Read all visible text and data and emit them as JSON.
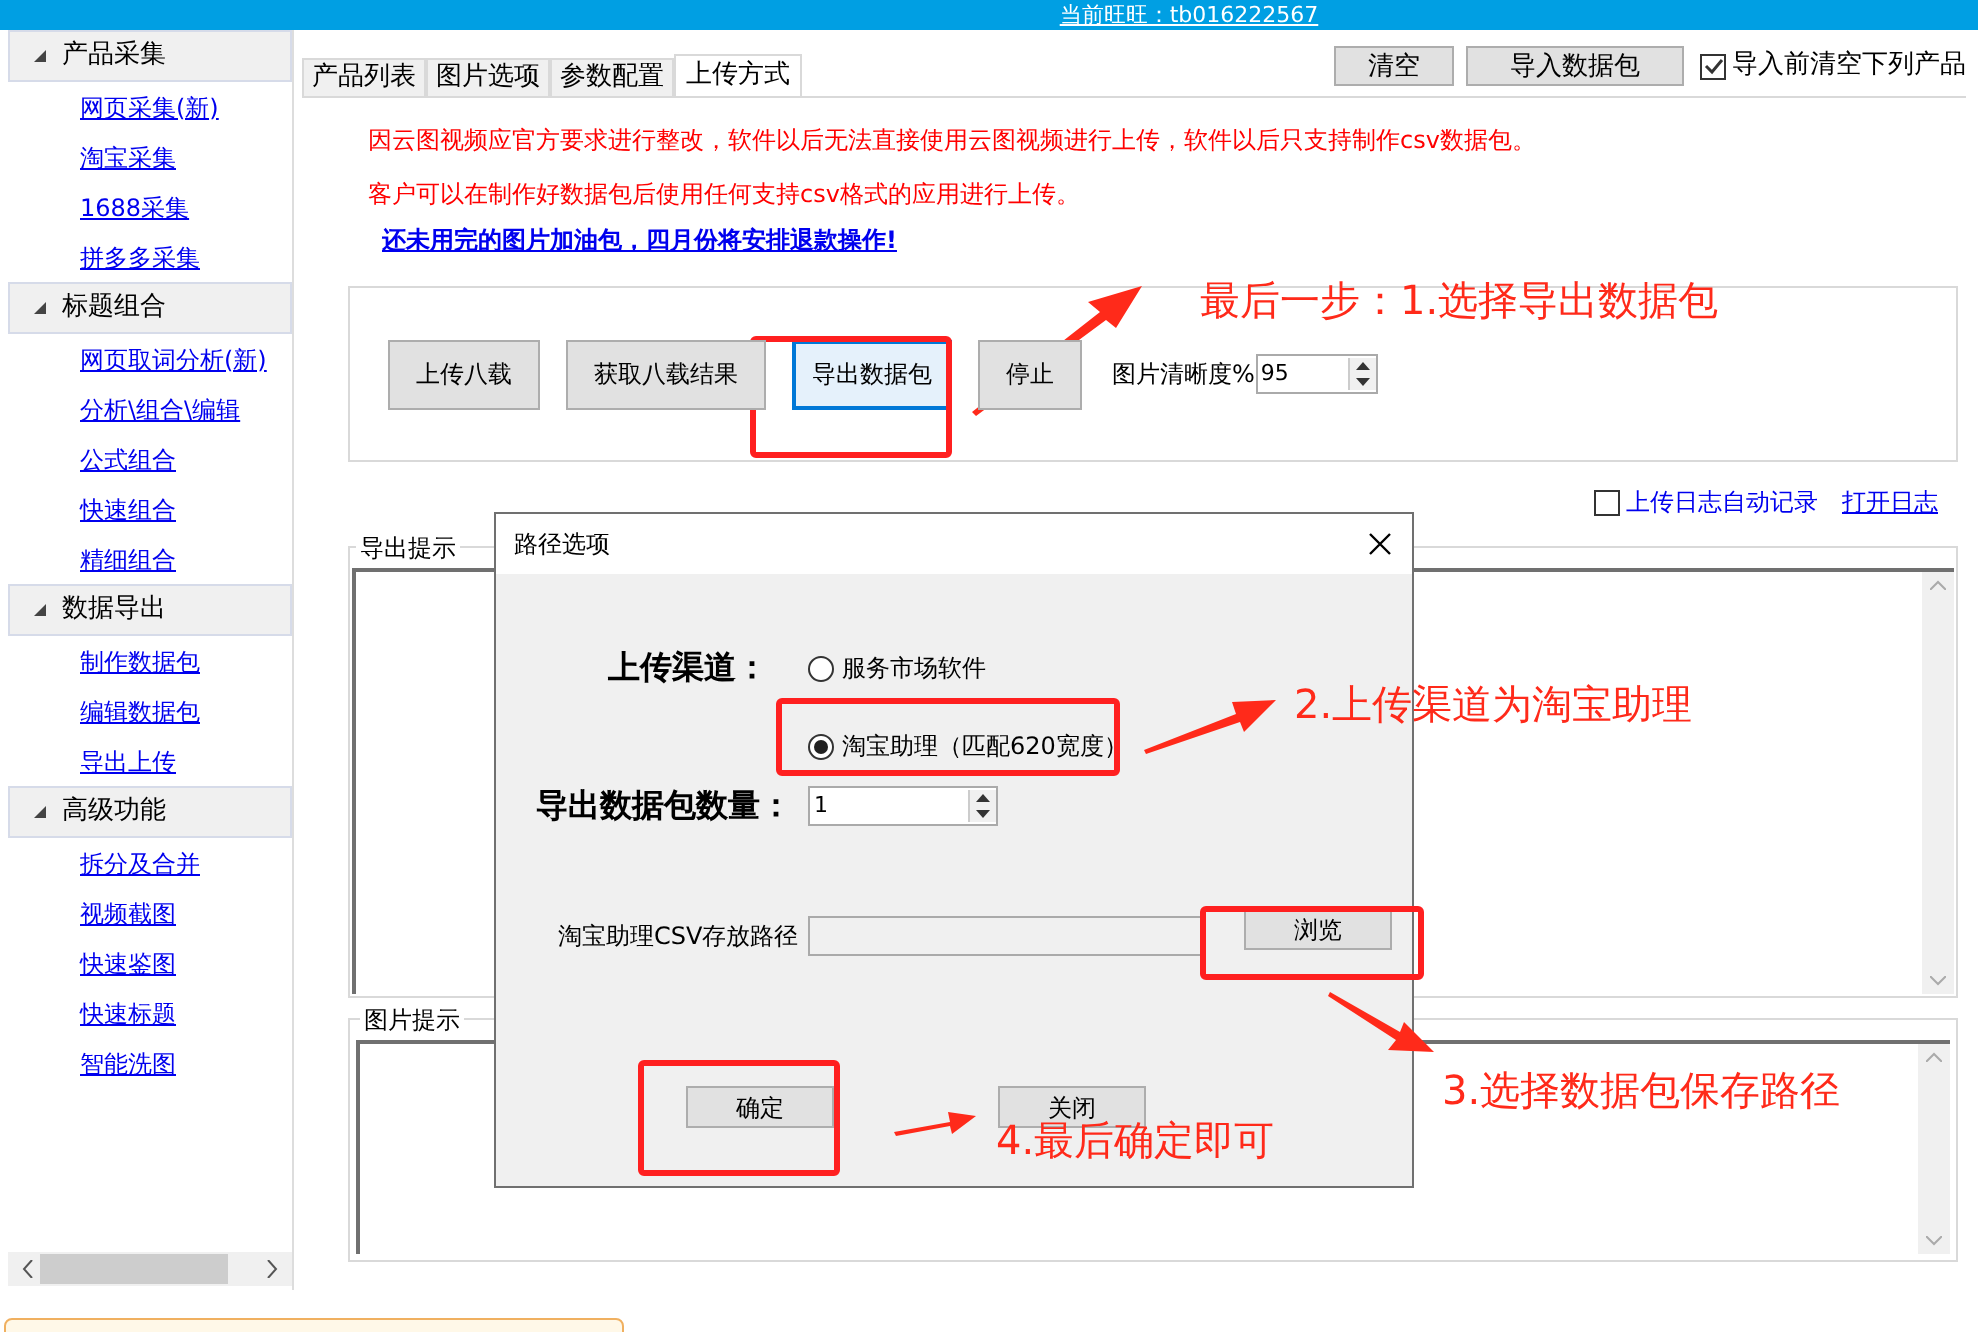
{
  "header": {
    "account": "当前旺旺：tb016222567"
  },
  "sidebar": {
    "groups": [
      {
        "title": "产品采集",
        "expanded": true,
        "items": [
          "网页采集(新)",
          "淘宝采集",
          "1688采集",
          "拼多多采集"
        ]
      },
      {
        "title": "标题组合",
        "expanded": true,
        "items": [
          "网页取词分析(新)",
          "分析\\组合\\编辑",
          "公式组合",
          "快速组合",
          "精细组合"
        ]
      },
      {
        "title": "数据导出",
        "expanded": true,
        "items": [
          "制作数据包",
          "编辑数据包",
          "导出上传"
        ]
      },
      {
        "title": "高级功能",
        "expanded": true,
        "items": [
          "拆分及合并",
          "视频截图",
          "快速鉴图",
          "快速标题",
          "智能洗图"
        ]
      }
    ]
  },
  "tabs": [
    {
      "label": "产品列表",
      "selected": false
    },
    {
      "label": "图片选项",
      "selected": false
    },
    {
      "label": "参数配置",
      "selected": false
    },
    {
      "label": "上传方式",
      "selected": true
    }
  ],
  "toolbar": {
    "buttons": [
      "清空",
      "导入数据包"
    ],
    "checkbox": {
      "label": "导入前清空下列产品",
      "checked": true
    }
  },
  "notices": [
    {
      "kind": "warning",
      "text": "因云图视频应官方要求进行整改，软件以后无法直接使用云图视频进行上传，软件以后只支持制作csv数据包。"
    },
    {
      "kind": "warning",
      "text": "客户可以在制作好数据包后使用任何支持csv格式的应用进行上传。"
    },
    {
      "kind": "link",
      "text": "还未用完的图片加油包，四月份将安排退款操作!"
    }
  ],
  "upload_panel": {
    "buttons": [
      {
        "label": "上传八载",
        "focused": false
      },
      {
        "label": "获取八载结果",
        "focused": false
      },
      {
        "label": "导出数据包",
        "focused": true
      },
      {
        "label": "停止",
        "focused": false
      }
    ],
    "clarity_label": "图片清晰度%",
    "clarity_value": "95"
  },
  "log": {
    "checkbox": {
      "label": "上传日志自动记录",
      "checked": false
    },
    "link": "打开日志"
  },
  "export_hint": {
    "title": "导出提示"
  },
  "image_hint": {
    "title": "图片提示"
  },
  "dialog": {
    "title": "路径选项",
    "channel_label": "上传渠道：",
    "options": [
      {
        "label": "服务市场软件",
        "selected": false
      },
      {
        "label": "淘宝助理（匹配620宽度）",
        "selected": true
      }
    ],
    "count_label": "导出数据包数量：",
    "count_value": "1",
    "path_label": "淘宝助理CSV存放路径",
    "browse": "浏览",
    "ok": "确定",
    "close": "关闭"
  },
  "annotations": [
    {
      "text": "最后一步：1.选择导出数据包"
    },
    {
      "text": "2.上传渠道为淘宝助理"
    },
    {
      "text": "3.选择数据包保存路径"
    },
    {
      "text": "4.最后确定即可"
    }
  ]
}
